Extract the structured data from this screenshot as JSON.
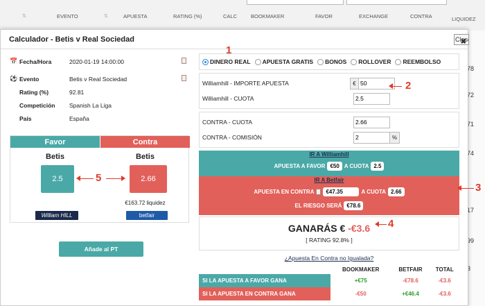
{
  "background": {
    "columns": [
      "EVENTO",
      "APUESTA",
      "RATING (%)",
      "CALC",
      "BOOKMAKER",
      "FAVOR",
      "EXCHANGE",
      "CONTRA",
      "LIQUIDEZ"
    ],
    "right_numbers": [
      "78",
      "72",
      "71",
      "74",
      "17",
      "99",
      "3"
    ]
  },
  "modal": {
    "title": "Calculador - Betis v Real Sociedad",
    "close_label": "Close"
  },
  "info": [
    {
      "icon": "calendar-icon",
      "glyph": "📅",
      "label": "Fecha/Hora",
      "value": "2020-01-19 14:00:00"
    },
    {
      "icon": "soccer-ball-icon",
      "glyph": "⚽",
      "label": "Evento",
      "value": "Betis v Real Sociedad"
    },
    {
      "icon": "",
      "glyph": "",
      "label": "Rating (%)",
      "value": "92.81"
    },
    {
      "icon": "",
      "glyph": "",
      "label": "Competición",
      "value": "Spanish La Liga"
    },
    {
      "icon": "",
      "glyph": "",
      "label": "País",
      "value": "España"
    }
  ],
  "favor": {
    "header": "Favor",
    "team": "Betis",
    "odds": "2.5",
    "logo": "William HILL",
    "color": "#4aa9a7"
  },
  "contra": {
    "header": "Contra",
    "team": "Betis",
    "odds": "2.66",
    "liquidity": "€163.72 liquidez",
    "logo": "betfair",
    "color": "#e2605a"
  },
  "add_button": "Añade al PT",
  "modes": [
    {
      "label": "DINERO REAL",
      "selected": true
    },
    {
      "label": "APUESTA GRATIS",
      "selected": false
    },
    {
      "label": "BONOS",
      "selected": false
    },
    {
      "label": "ROLLOVER",
      "selected": false
    },
    {
      "label": "REEMBOLSO",
      "selected": false
    }
  ],
  "fields": {
    "stake_label": "Williamhill - IMPORTE APUESTA",
    "stake_addon": "€",
    "stake_value": "50",
    "back_odds_label": "Williamhill - CUOTA",
    "back_odds_value": "2.5",
    "lay_odds_label": "CONTRA - CUOTA",
    "lay_odds_value": "2.66",
    "commission_label": "CONTRA - COMISIÓN",
    "commission_value": "2",
    "commission_addon": "%"
  },
  "back_box": {
    "link": "IR A Williamhill",
    "text_before": "APUESTA A FAVOR",
    "amount": "€50",
    "text_mid": "A CUOTA",
    "odds": "2.5"
  },
  "lay_box": {
    "link": "IR A Betfair",
    "text_before": "APUESTA EN CONTRA",
    "amount": "€47.35",
    "text_mid": "A CUOTA",
    "odds": "2.66",
    "risk_label": "EL RIESGO SERÁ",
    "risk": "€78.6"
  },
  "result": {
    "prefix": "GANARÁS €",
    "value": "-€3.6",
    "rating": "[ RATING 92.8% ]"
  },
  "unmatched_link": "¿Apuesta En Contra no Igualada?",
  "summary": {
    "headers": [
      "BOOKMAKER",
      "BETFAIR",
      "TOTAL"
    ],
    "rows": [
      {
        "label": "SI LA APUESTA A FAVOR GANA",
        "bookmaker": "+€75",
        "betfair": "-€78.6",
        "total": "-€3.6",
        "color": "#4aa9a7"
      },
      {
        "label": "SI LA APUESTA EN CONTRA GANA",
        "bookmaker": "-€50",
        "betfair": "+€46.4",
        "total": "-€3.6",
        "color": "#e2605a"
      }
    ]
  },
  "annotations": [
    "1",
    "2",
    "3",
    "4",
    "5"
  ]
}
